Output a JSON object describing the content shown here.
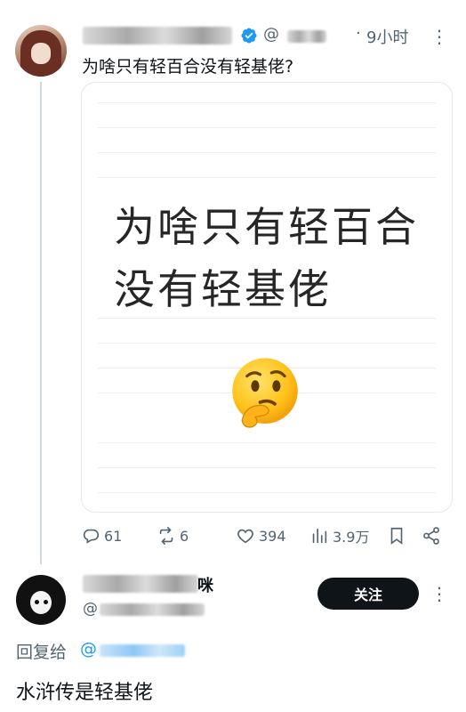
{
  "tweet": {
    "handle_prefix": "@",
    "separator": "·",
    "time": "9小时",
    "text": "为啥只有轻百合没有轻基佬?",
    "image_line1": "为啥只有轻百合",
    "image_line2": "没有轻基佬",
    "image_emoji": "thinking-face",
    "stats": {
      "replies": "61",
      "retweets": "6",
      "likes": "394",
      "views": "3.9万"
    }
  },
  "reply": {
    "name_tail": "咪",
    "handle_prefix": "@",
    "follow_label": "关注",
    "replying_to_label": "回复给",
    "replying_to_handle_prefix": "@",
    "text": "水浒传是轻基佬"
  },
  "colors": {
    "accent": "#1d9bf0",
    "muted": "#536471",
    "text": "#0f1419",
    "thread_line": "#cfd9de"
  }
}
